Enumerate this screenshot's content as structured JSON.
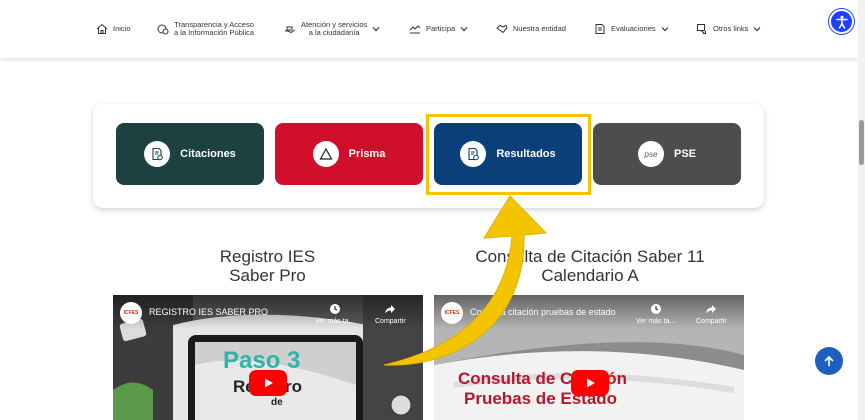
{
  "nav": {
    "items": [
      {
        "id": "inicio",
        "lines": [
          "Inicio"
        ],
        "icon": "home-icon",
        "dropdown": false
      },
      {
        "id": "transparencia",
        "lines": [
          "Transparencia y Acceso",
          "a la Información Pública"
        ],
        "icon": "transparency-icon",
        "dropdown": false
      },
      {
        "id": "atencion",
        "lines": [
          "Atención y servicios",
          "a la ciudadanía"
        ],
        "icon": "service-icon",
        "dropdown": true
      },
      {
        "id": "participa",
        "lines": [
          "Participa"
        ],
        "icon": "participate-icon",
        "dropdown": true
      },
      {
        "id": "entidad",
        "lines": [
          "Nuestra entidad"
        ],
        "icon": "handshake-icon",
        "dropdown": false
      },
      {
        "id": "evaluaciones",
        "lines": [
          "Evaluaciones"
        ],
        "icon": "evaluation-icon",
        "dropdown": true
      },
      {
        "id": "otros",
        "lines": [
          "Otros links"
        ],
        "icon": "links-icon",
        "dropdown": true
      }
    ]
  },
  "services": [
    {
      "label": "Citaciones",
      "color": "#1d4040",
      "icon": "document-icon"
    },
    {
      "label": "Prisma",
      "color": "#d0102a",
      "icon": "triangle-icon"
    },
    {
      "label": "Resultados",
      "color": "#0b3f7a",
      "icon": "document-icon"
    },
    {
      "label": "PSE",
      "color": "#4d4d4d",
      "icon": "pse-icon",
      "icon_text": "pse"
    }
  ],
  "highlight_color": "#f4c400",
  "sections": [
    {
      "title_lines": [
        "Registro IES",
        "Saber Pro"
      ]
    },
    {
      "title_lines": [
        "Consulta de Citación Saber 11",
        "Calendario A"
      ]
    }
  ],
  "videos": [
    {
      "title": "REGISTRO IES SABER PRO",
      "watch_later": "Ver más ta...",
      "share": "Compartir",
      "overlay_line1": "Paso 3",
      "overlay_line2": "Registro",
      "overlay_line3": "de"
    },
    {
      "title": "Consulta citación pruebas de estado",
      "watch_later": "Ver más ta...",
      "share": "Compartir",
      "overlay_line1": "Consulta de Citación",
      "overlay_line2": "Pruebas de Estado"
    }
  ],
  "colors": {
    "accessibility": "#1e40ff",
    "scroll_top": "#1f5fc0",
    "youtube": "#ff0000"
  }
}
